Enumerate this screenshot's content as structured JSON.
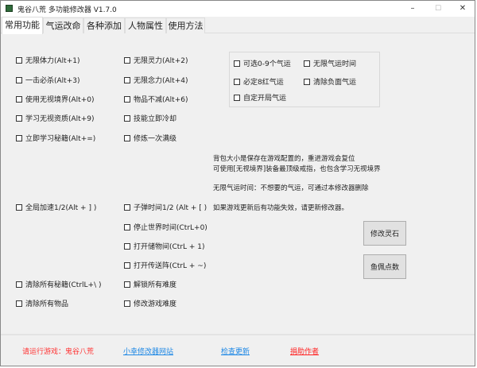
{
  "window": {
    "title": "鬼谷八荒 多功能修改器  V1.7.0",
    "minimize": "–",
    "maximize": "☐",
    "close": "✕"
  },
  "tabs": [
    {
      "label": "常用功能",
      "active": true
    },
    {
      "label": "气运改命"
    },
    {
      "label": "各种添加"
    },
    {
      "label": "人物属性"
    },
    {
      "label": "使用方法"
    }
  ],
  "col1": [
    "无限体力(Alt+1)",
    "一击必杀(Alt+3)",
    "使用无视境界(Alt+0)",
    "学习无视资质(Alt+9)",
    "立即学习秘籍(Alt+=)",
    "全局加速1/2(Alt + ] )",
    "清除所有秘籍(CtrlL+\\ )",
    "清除所有物品"
  ],
  "col2": [
    "无限灵力(Alt+2)",
    "无限念力(Alt+4)",
    "物品不减(Alt+6)",
    "技能立即冷却",
    "修炼一次满级",
    "子弹时间1/2 (Alt + [ )",
    "停止世界时间(CtrL+0)",
    "打开储物间(CtrL + 1)",
    "打开传送阵(CtrL + ~)",
    "解锁所有难度",
    "修改游戏难度"
  ],
  "fortune": [
    "可选0-9个气运",
    "无限气运时间",
    "必定8红气运",
    "清除负面气运",
    "自定开局气运"
  ],
  "notes": [
    "背包大小是保存在游戏配置的，重进游戏会复位",
    "可使用[无视境界]装备最顶级戒指，也包含学习无视境界",
    "无限气运时间：不想要的气运，可通过本修改器删除",
    "如果游戏更新后有功能失效，请更新修改器。"
  ],
  "buttons": {
    "spirit_stone": "修改灵石",
    "fish_points": "鱼佩点数"
  },
  "footer": {
    "status": "请运行游戏：鬼谷八荒",
    "site": "小幸修改器网站",
    "update": "检查更新",
    "donate": "捐助作者"
  },
  "colors": {
    "status": "#ff3333",
    "link": "#1e88e5",
    "donate": "#ff2222"
  }
}
